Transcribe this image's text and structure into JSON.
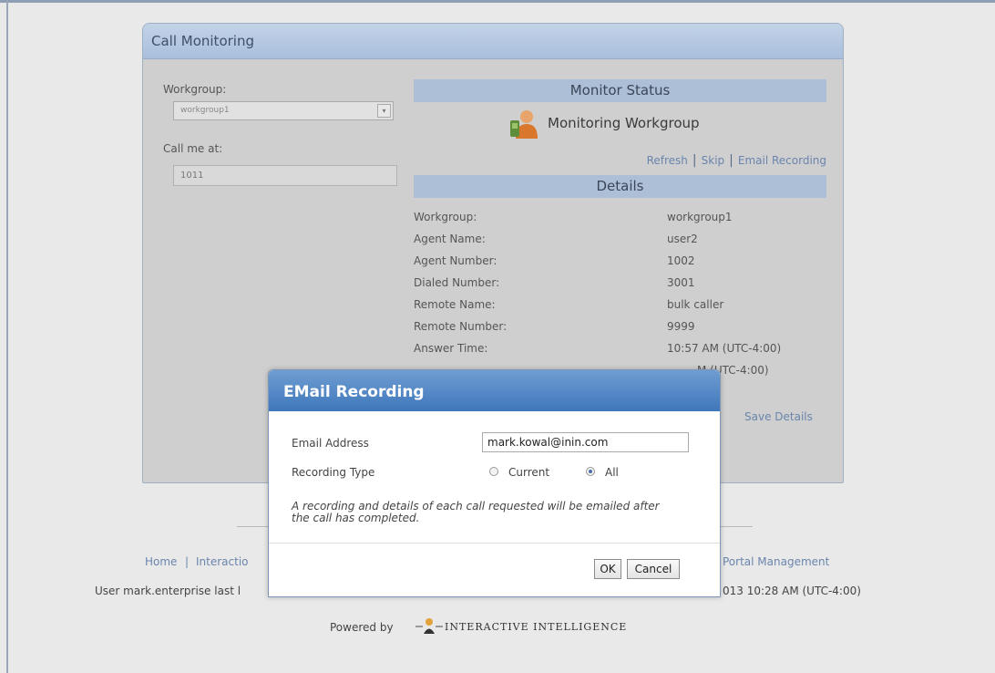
{
  "panel": {
    "title": "Call Monitoring",
    "workgroup_label": "Workgroup:",
    "workgroup_value": "workgroup1",
    "callme_label": "Call me at:",
    "callme_value": "1011",
    "monitor_status_heading": "Monitor Status",
    "monitor_status_text": "Monitoring Workgroup",
    "links": [
      "Refresh",
      "Skip",
      "Email Recording"
    ],
    "details_heading": "Details",
    "details": [
      {
        "label": "Workgroup:",
        "value": "workgroup1"
      },
      {
        "label": "Agent Name:",
        "value": "user2"
      },
      {
        "label": "Agent Number:",
        "value": "1002"
      },
      {
        "label": "Dialed Number:",
        "value": "3001"
      },
      {
        "label": "Remote Name:",
        "value": "bulk caller"
      },
      {
        "label": "Remote Number:",
        "value": "9999"
      },
      {
        "label": "Answer Time:",
        "value": "10:57 AM (UTC-4:00)"
      }
    ],
    "partial_row_value": "M (UTC-4:00)",
    "save_details": "Save Details"
  },
  "footer": {
    "home": "Home",
    "sep": "|",
    "interaction": "Interactio",
    "portal_management": "Portal Management",
    "user_prefix": "User mark.enterprise last l",
    "user_suffix": "013 10:28 AM (UTC-4:00)",
    "powered_by": "Powered by",
    "brand": "Interactive Intelligence"
  },
  "dialog": {
    "title": "EMail Recording",
    "email_label": "Email Address",
    "email_value": "mark.kowal@inin.com",
    "recording_type_label": "Recording Type",
    "option_current": "Current",
    "option_all": "All",
    "selected_option": "All",
    "note": "A recording and details of each call requested will be emailed after the call has completed.",
    "ok": "OK",
    "cancel": "Cancel"
  },
  "colors": {
    "header_blue": "#aabfdc",
    "dialog_title": "#4a7fc1",
    "link": "#6a85ad"
  }
}
